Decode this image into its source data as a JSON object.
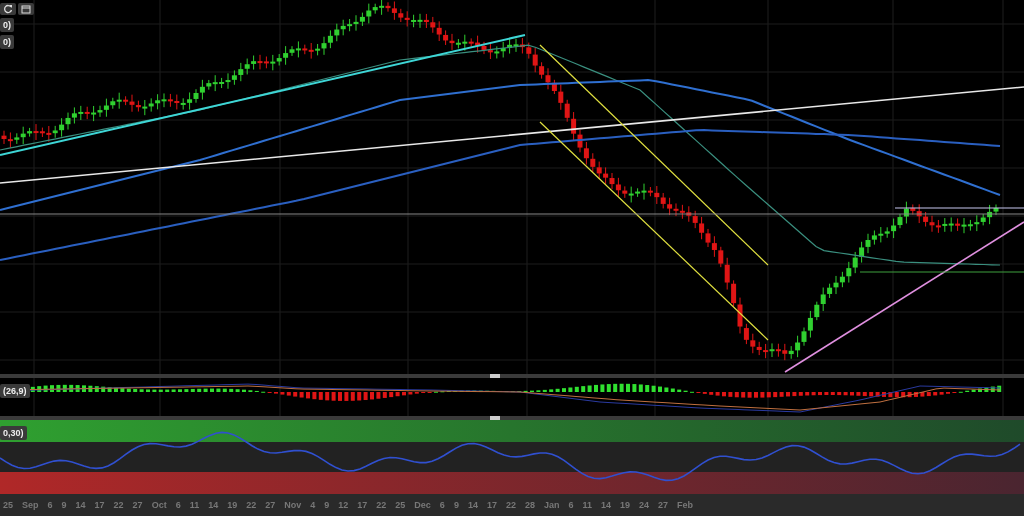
{
  "indicator_tags": [
    {
      "label": "0)"
    },
    {
      "label": "0)"
    }
  ],
  "macd_pane": {
    "tag": "(26,9)"
  },
  "rsi_pane": {
    "tag": "0,30)"
  },
  "time_axis": {
    "labels": [
      "25",
      "Sep",
      "6",
      "9",
      "14",
      "17",
      "22",
      "27",
      "Oct",
      "6",
      "11",
      "14",
      "19",
      "22",
      "27",
      "Nov",
      "4",
      "9",
      "12",
      "17",
      "22",
      "25",
      "Dec",
      "6",
      "9",
      "14",
      "17",
      "22",
      "28",
      "Jan",
      "6",
      "11",
      "14",
      "19",
      "24",
      "27",
      "Feb"
    ]
  }
}
